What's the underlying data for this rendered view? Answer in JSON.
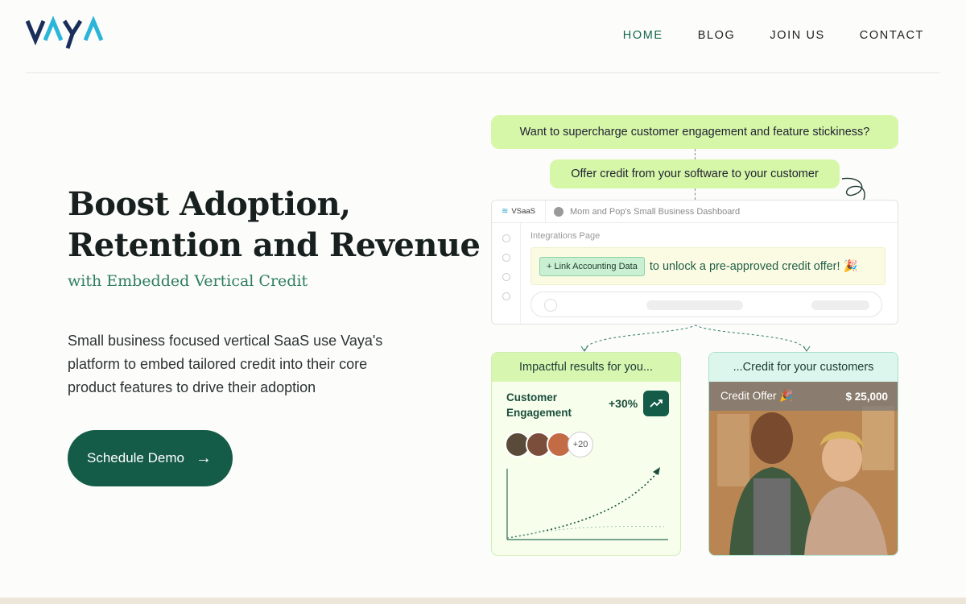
{
  "brand": {
    "logo_text": "VAYA",
    "colors": {
      "accent": "#145c47",
      "logo_dark": "#1a2e5a",
      "logo_light": "#2bb5d8"
    }
  },
  "nav": {
    "home": "HOME",
    "blog": "BLOG",
    "join": "JOIN US",
    "contact": "CONTACT"
  },
  "hero": {
    "title_line1": "Boost Adoption,",
    "title_line2": "Retention and Revenue",
    "subtitle": "with Embedded Vertical Credit",
    "description": "Small business focused vertical SaaS use Vaya's platform to embed tailored credit into their core product features to drive their adoption",
    "cta_label": "Schedule Demo",
    "cta_icon": "arrow-right-icon"
  },
  "illustration": {
    "question": "Want to supercharge customer engagement and feature stickiness?",
    "answer": "Offer credit from your software to your customer",
    "dashboard": {
      "app_name": "VSaaS",
      "title": "Mom and Pop's Small Business Dashboard",
      "page_label": "Integrations Page",
      "link_button": "+ Link Accounting Data",
      "offer_text": "to unlock a pre-approved credit offer! 🎉"
    },
    "left_card": {
      "header": "Impactful results for you...",
      "metric_label_1": "Customer",
      "metric_label_2": "Engagement",
      "metric_value": "+30%",
      "more_count": "+20"
    },
    "right_card": {
      "header": "...Credit for your customers",
      "offer_label": "Credit Offer 🎉",
      "offer_amount": "$ 25,000"
    }
  }
}
